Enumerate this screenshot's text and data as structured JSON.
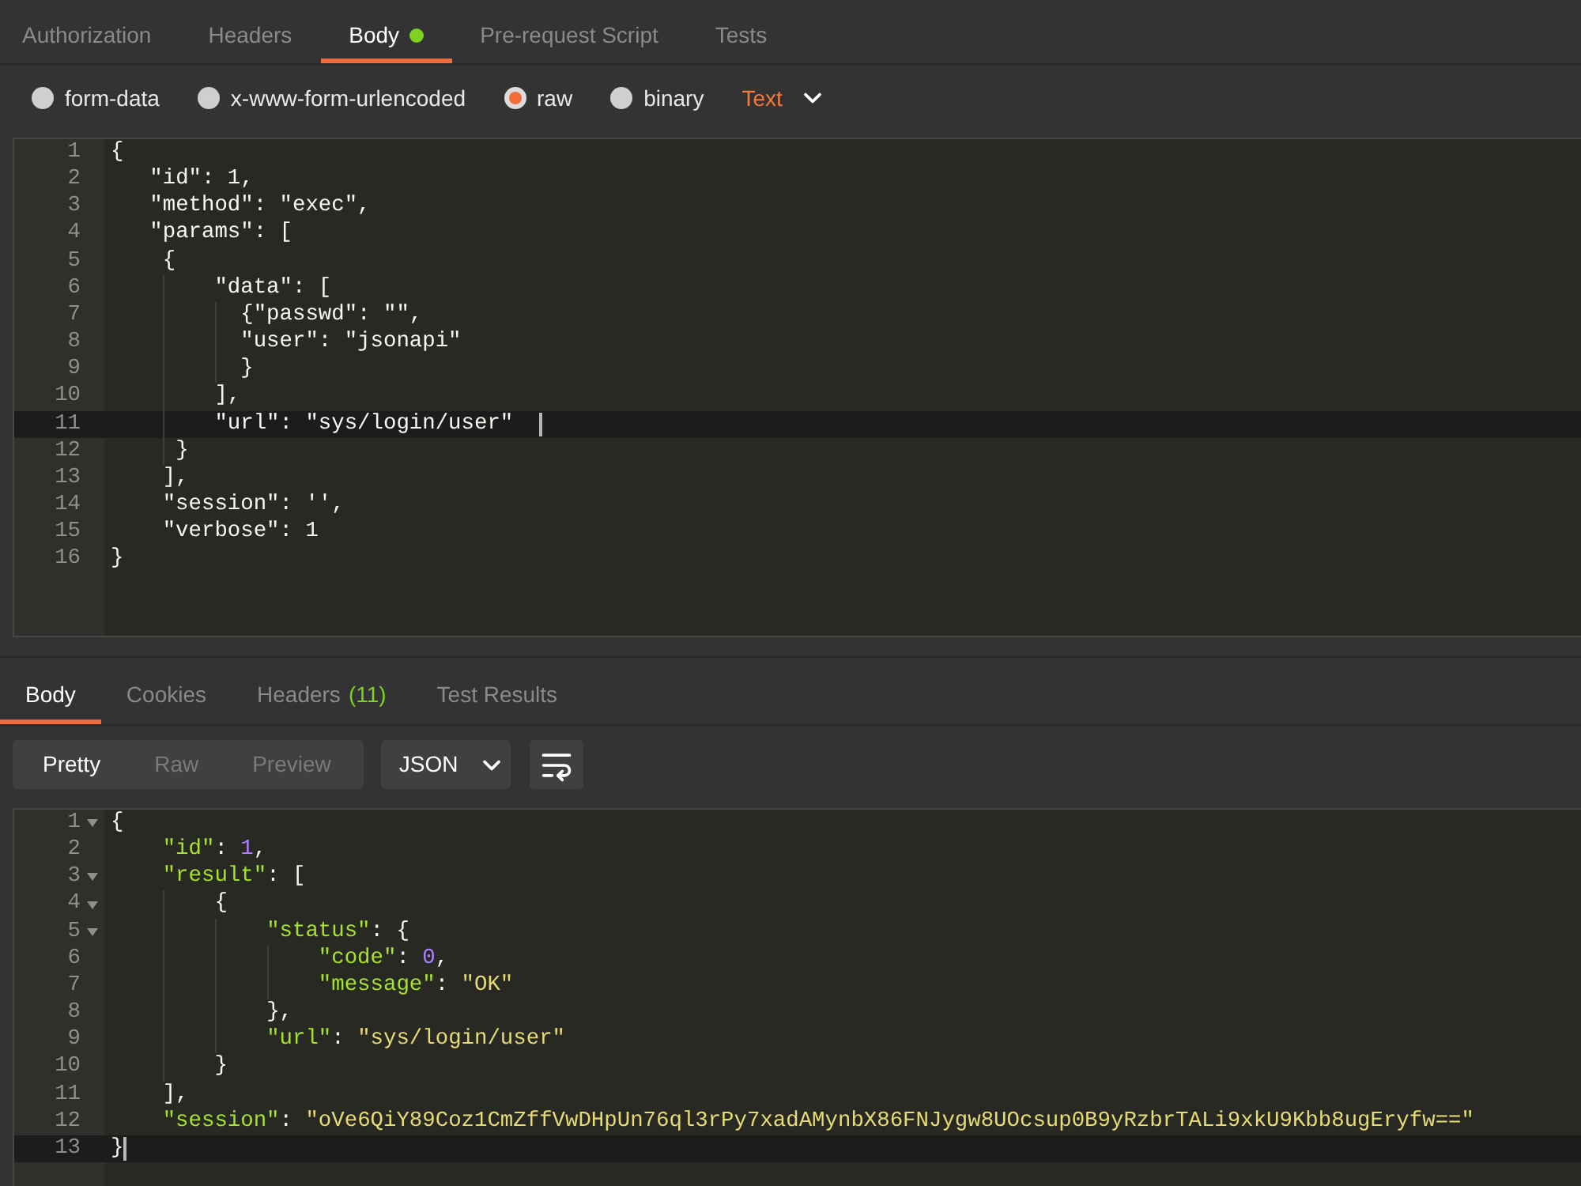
{
  "request": {
    "tabs": [
      {
        "label": "Authorization",
        "selected": false,
        "dot": false
      },
      {
        "label": "Headers",
        "selected": false,
        "dot": false
      },
      {
        "label": "Body",
        "selected": true,
        "dot": true
      },
      {
        "label": "Pre-request Script",
        "selected": false,
        "dot": false
      },
      {
        "label": "Tests",
        "selected": false,
        "dot": false
      }
    ],
    "body_types": [
      {
        "label": "form-data",
        "selected": false
      },
      {
        "label": "x-www-form-urlencoded",
        "selected": false
      },
      {
        "label": "raw",
        "selected": true
      },
      {
        "label": "binary",
        "selected": false
      }
    ],
    "format": {
      "label": "Text"
    },
    "editor": {
      "kind": "plain",
      "lines": [
        {
          "number": "1",
          "text": "{",
          "active": false
        },
        {
          "number": "2",
          "text": "   \"id\": 1,",
          "active": false
        },
        {
          "number": "3",
          "text": "   \"method\": \"exec\",",
          "active": false
        },
        {
          "number": "4",
          "text": "   \"params\": [",
          "active": false
        },
        {
          "number": "5",
          "text": "    {",
          "active": false
        },
        {
          "number": "6",
          "text": "        \"data\": [",
          "active": false
        },
        {
          "number": "7",
          "text": "          {\"passwd\": \"\",",
          "active": false
        },
        {
          "number": "8",
          "text": "          \"user\": \"jsonapi\"",
          "active": false
        },
        {
          "number": "9",
          "text": "          }",
          "active": false
        },
        {
          "number": "10",
          "text": "        ],",
          "active": false
        },
        {
          "number": "11",
          "text": "        \"url\": \"sys/login/user\"  ",
          "active": true
        },
        {
          "number": "12",
          "text": "     }",
          "active": false
        },
        {
          "number": "13",
          "text": "    ],",
          "active": false
        },
        {
          "number": "14",
          "text": "    \"session\": '',",
          "active": false
        },
        {
          "number": "15",
          "text": "    \"verbose\": 1",
          "active": false
        },
        {
          "number": "16",
          "text": "}",
          "active": false
        }
      ]
    }
  },
  "response": {
    "tabs": [
      {
        "label": "Body",
        "selected": true
      },
      {
        "label": "Cookies",
        "selected": false
      },
      {
        "label": "Headers",
        "count": "(11)",
        "selected": false
      },
      {
        "label": "Test Results",
        "selected": false
      }
    ],
    "views": [
      {
        "label": "Pretty",
        "selected": true
      },
      {
        "label": "Raw",
        "selected": false
      },
      {
        "label": "Preview",
        "selected": false
      }
    ],
    "format": {
      "label": "JSON"
    },
    "editor": {
      "kind": "json",
      "lines": [
        {
          "number": "1",
          "text": "{",
          "active": false,
          "foldable": true
        },
        {
          "number": "2",
          "text": "    \"id\": 1,",
          "active": false,
          "foldable": false
        },
        {
          "number": "3",
          "text": "    \"result\": [",
          "active": false,
          "foldable": true
        },
        {
          "number": "4",
          "text": "        {",
          "active": false,
          "foldable": true
        },
        {
          "number": "5",
          "text": "            \"status\": {",
          "active": false,
          "foldable": true
        },
        {
          "number": "6",
          "text": "                \"code\": 0,",
          "active": false,
          "foldable": false
        },
        {
          "number": "7",
          "text": "                \"message\": \"OK\"",
          "active": false,
          "foldable": false
        },
        {
          "number": "8",
          "text": "            },",
          "active": false,
          "foldable": false
        },
        {
          "number": "9",
          "text": "            \"url\": \"sys/login/user\"",
          "active": false,
          "foldable": false
        },
        {
          "number": "10",
          "text": "        }",
          "active": false,
          "foldable": false
        },
        {
          "number": "11",
          "text": "    ],",
          "active": false,
          "foldable": false
        },
        {
          "number": "12",
          "text": "    \"session\": \"oVe6QiY89Coz1CmZffVwDHpUn76ql3rPy7xadAMynbX86FNJygw8UOcsup0B9yRzbrTALi9xkU9Kbb8ugEryfw==\"",
          "active": false,
          "foldable": false
        },
        {
          "number": "13",
          "text": "}",
          "active": true,
          "foldable": false
        }
      ]
    }
  }
}
